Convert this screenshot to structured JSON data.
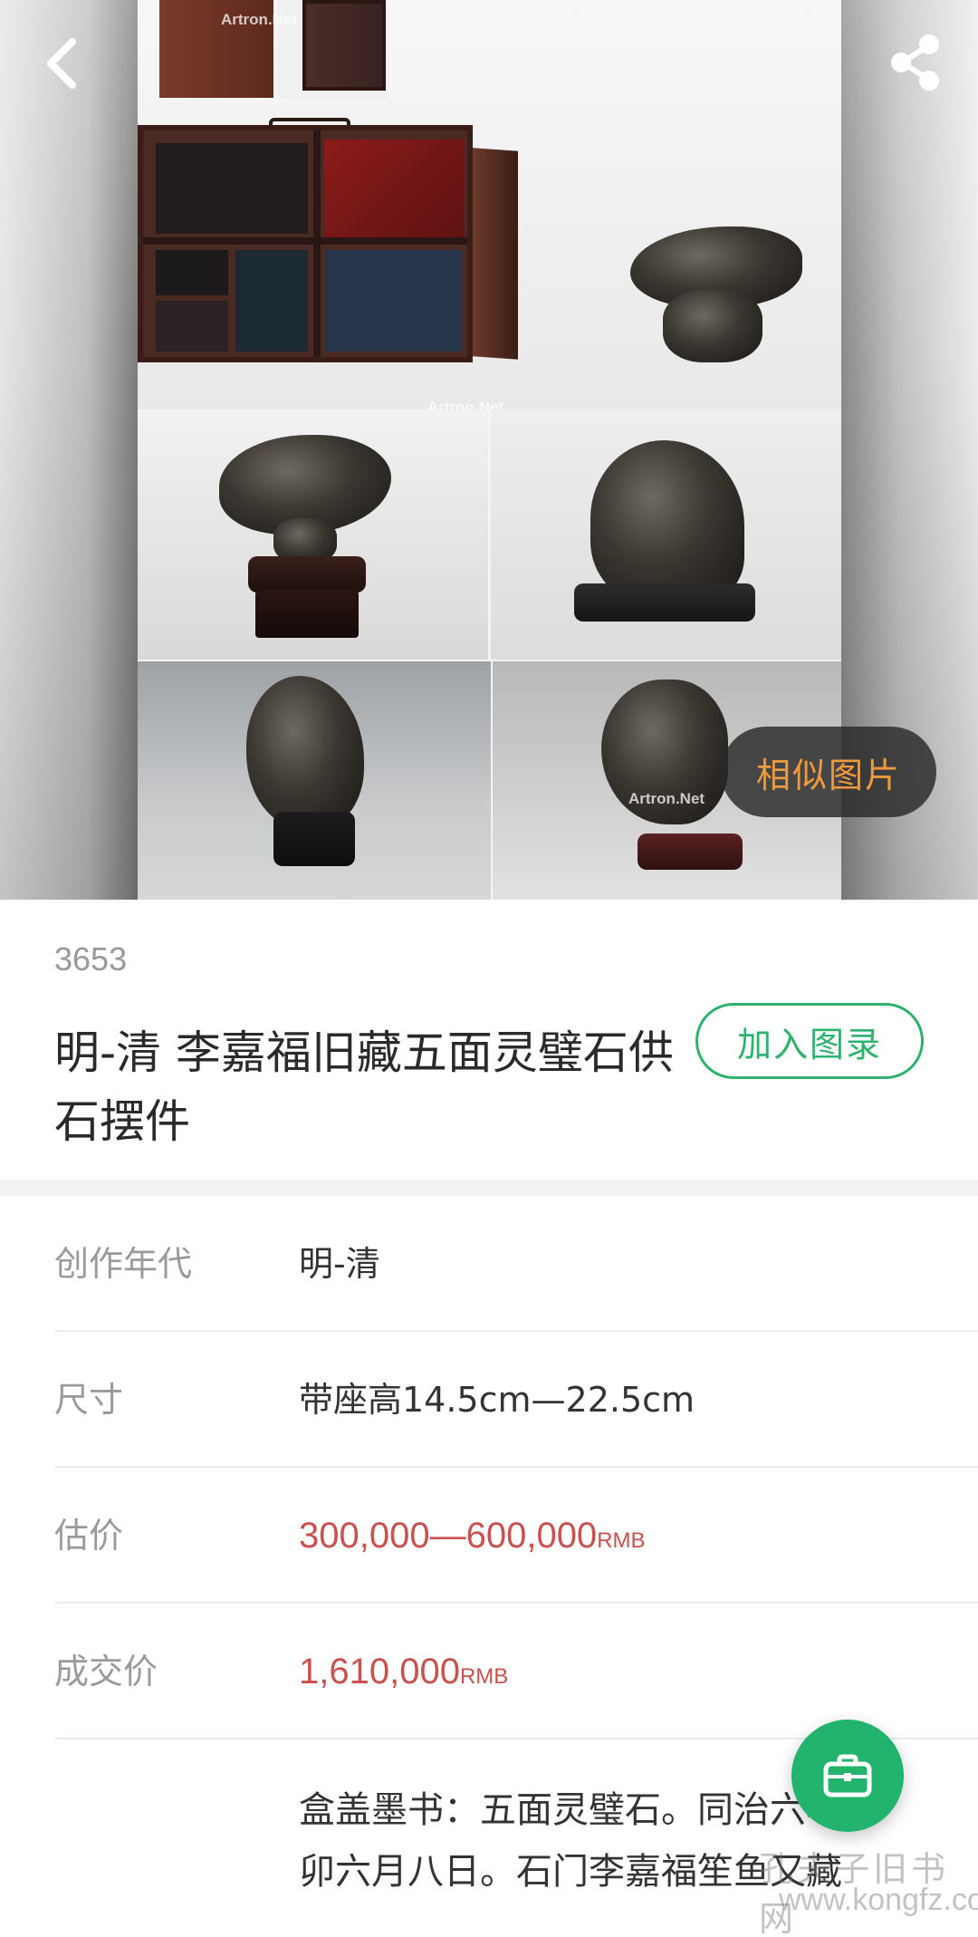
{
  "hero": {
    "watermark_text": "Artron.Net",
    "back_icon": "chevron-left-icon",
    "share_icon": "share-icon",
    "similar_button_label": "相似图片"
  },
  "lot": {
    "number": "3653",
    "title": "明-清 李嘉福旧藏五面灵璧石供石摆件",
    "add_catalog_label": "加入图录"
  },
  "details": [
    {
      "label": "创作年代",
      "value": "明-清"
    },
    {
      "label": "尺寸",
      "value": "带座高14.5cm—22.5cm"
    },
    {
      "label": "估价",
      "value": "300,000—600,000",
      "unit": "RMB"
    },
    {
      "label": "成交价",
      "value": "1,610,000",
      "unit": "RMB"
    }
  ],
  "note": {
    "text": "盒盖墨书：五面灵璧石。同治六年丁卯六月八日。石门李嘉福笙鱼又藏"
  },
  "fab": {
    "icon": "briefcase-icon"
  },
  "site_watermark": {
    "name": "孔夫子旧书网",
    "url": "www.kongfz.com"
  },
  "colors": {
    "accent_green": "#2db36e",
    "price_red": "#c9514f",
    "similar_orange": "#f09a3e"
  }
}
